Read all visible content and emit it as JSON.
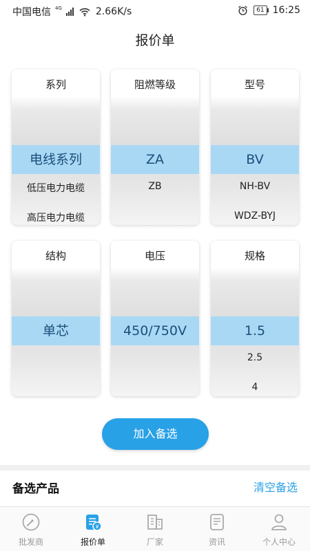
{
  "status_bar": {
    "carrier": "中国电信",
    "network": "4G",
    "speed": "2.66K/s",
    "battery": "61",
    "time": "16:25"
  },
  "page": {
    "title": "报价单"
  },
  "pickers": [
    {
      "label": "系列",
      "selected": "电线系列",
      "options_below": [
        "低压电力电缆",
        "高压电力电缆"
      ]
    },
    {
      "label": "阻燃等级",
      "selected": "ZA",
      "options_below": [
        "ZB",
        ""
      ]
    },
    {
      "label": "型号",
      "selected": "BV",
      "options_below": [
        "NH-BV",
        "WDZ-BYJ"
      ]
    },
    {
      "label": "结构",
      "selected": "单芯",
      "options_below": [
        "",
        ""
      ]
    },
    {
      "label": "电压",
      "selected": "450/750V",
      "options_below": [
        "",
        ""
      ]
    },
    {
      "label": "规格",
      "selected": "1.5",
      "options_below": [
        "2.5",
        "4"
      ]
    }
  ],
  "actions": {
    "add_label": "加入备选"
  },
  "selection": {
    "title": "备选产品",
    "clear_label": "清空备选"
  },
  "tabs": [
    {
      "label": "批发商",
      "icon": "dial-icon",
      "active": false
    },
    {
      "label": "报价单",
      "icon": "quote-document-icon",
      "active": true
    },
    {
      "label": "厂家",
      "icon": "building-icon",
      "active": false
    },
    {
      "label": "资讯",
      "icon": "news-icon",
      "active": false
    },
    {
      "label": "个人中心",
      "icon": "user-icon",
      "active": false
    }
  ],
  "colors": {
    "accent": "#29a1e6",
    "selected_row": "#a9d8f5",
    "selected_text": "#1b4f7a"
  }
}
